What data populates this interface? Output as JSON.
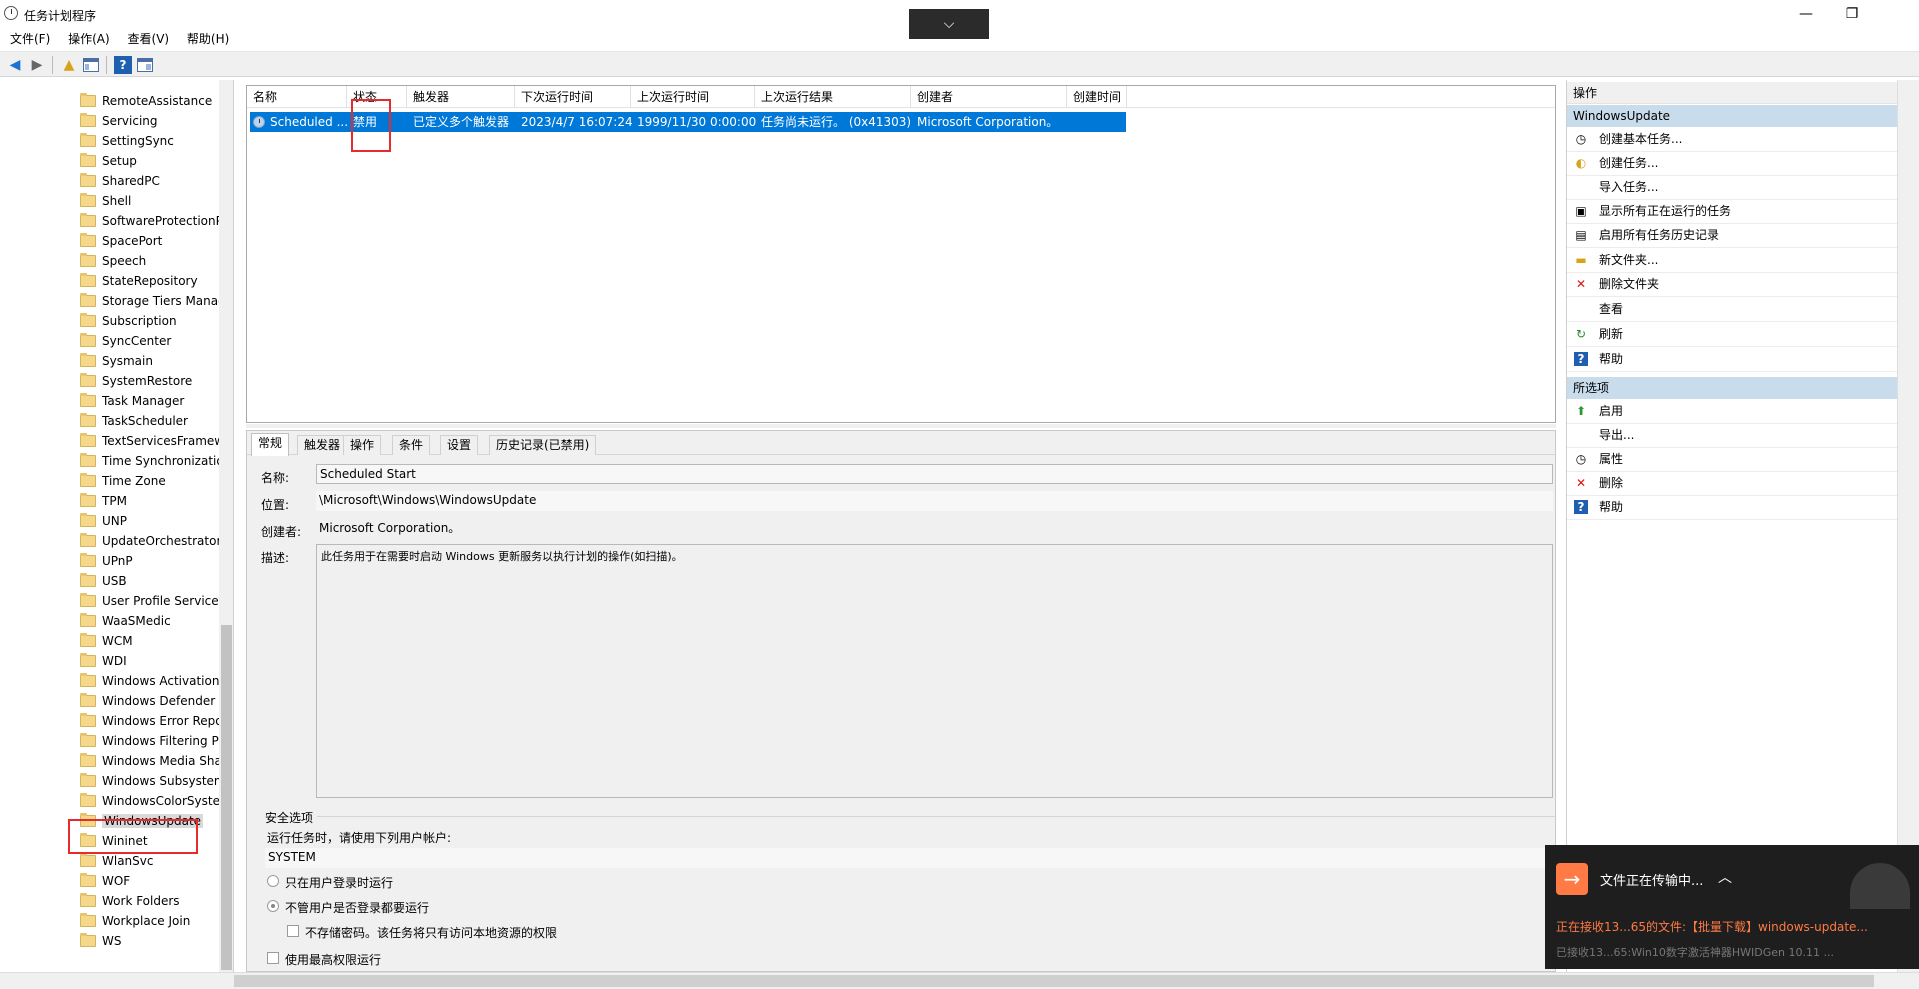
{
  "window": {
    "title": "任务计划程序",
    "collapse_glyph": "⌵",
    "minimize_glyph": "—",
    "restore_glyph": "❐"
  },
  "menu": [
    "文件(F)",
    "操作(A)",
    "查看(V)",
    "帮助(H)"
  ],
  "toolbar": {
    "back_glyph": "◀",
    "forward_glyph": "▶",
    "up_glyph": "▲",
    "help_glyph": "?"
  },
  "tree": {
    "items": [
      "RemoteAssistance",
      "Servicing",
      "SettingSync",
      "Setup",
      "SharedPC",
      "Shell",
      "SoftwareProtectionPlatform",
      "SpacePort",
      "Speech",
      "StateRepository",
      "Storage Tiers Management",
      "Subscription",
      "SyncCenter",
      "Sysmain",
      "SystemRestore",
      "Task Manager",
      "TaskScheduler",
      "TextServicesFramework",
      "Time Synchronization",
      "Time Zone",
      "TPM",
      "UNP",
      "UpdateOrchestrator",
      "UPnP",
      "USB",
      "User Profile Service",
      "WaaSMedic",
      "WCM",
      "WDI",
      "Windows Activation",
      "Windows Defender",
      "Windows Error Reporting",
      "Windows Filtering Platform",
      "Windows Media Sharing",
      "Windows Subsystem",
      "WindowsColorSystem",
      "WindowsUpdate",
      "Wininet",
      "WlanSvc",
      "WOF",
      "Work Folders",
      "Workplace Join",
      "WS"
    ],
    "selected": "WindowsUpdate"
  },
  "task_list": {
    "columns": [
      "名称",
      "状态",
      "触发器",
      "下次运行时间",
      "上次运行时间",
      "上次运行结果",
      "创建者",
      "创建时间"
    ],
    "rows": [
      {
        "name": "Scheduled ...",
        "status": "禁用",
        "trigger": "已定义多个触发器",
        "next_run": "2023/4/7 16:07:24",
        "last_run": "1999/11/30 0:00:00",
        "last_result": "任务尚未运行。 (0x41303)",
        "author": "Microsoft Corporation。",
        "created": ""
      }
    ]
  },
  "details": {
    "tabs": [
      "常规",
      "触发器",
      "操作",
      "条件",
      "设置",
      "历史记录(已禁用)"
    ],
    "active_tab": "常规",
    "name_label": "名称:",
    "name_value": "Scheduled Start",
    "location_label": "位置:",
    "location_value": "\\Microsoft\\Windows\\WindowsUpdate",
    "author_label": "创建者:",
    "author_value": "Microsoft Corporation。",
    "desc_label": "描述:",
    "desc_value": "此任务用于在需要时启动 Windows 更新服务以执行计划的操作(如扫描)。",
    "security": {
      "group_label": "安全选项",
      "run_as_label": "运行任务时，请使用下列用户帐户:",
      "account": "SYSTEM",
      "radio_logged_on": "只在用户登录时运行",
      "radio_any": "不管用户是否登录都要运行",
      "no_store_password": "不存储密码。该任务将只有访问本地资源的权限",
      "highest_privileges": "使用最高权限运行"
    }
  },
  "actions": {
    "header": "操作",
    "section1": "WindowsUpdate",
    "items1": [
      "创建基本任务...",
      "创建任务...",
      "导入任务...",
      "显示所有正在运行的任务",
      "启用所有任务历史记录",
      "新文件夹...",
      "删除文件夹",
      "查看",
      "刷新",
      "帮助"
    ],
    "section2": "所选项",
    "items2": [
      "启用",
      "导出...",
      "属性",
      "删除",
      "帮助"
    ]
  },
  "toast": {
    "icon_glyph": "→",
    "title": "文件正在传输中...",
    "chevron_glyph": "︿",
    "line1": "正在接收13...65的文件:【批量下载】windows-update...",
    "line2": "已接收13...65:Win10数字激活神器HWIDGen 10.11 ..."
  },
  "colors": {
    "selection": "#0078d7",
    "highlight": "#e52b2b",
    "toast_accent": "#ff7a45"
  }
}
